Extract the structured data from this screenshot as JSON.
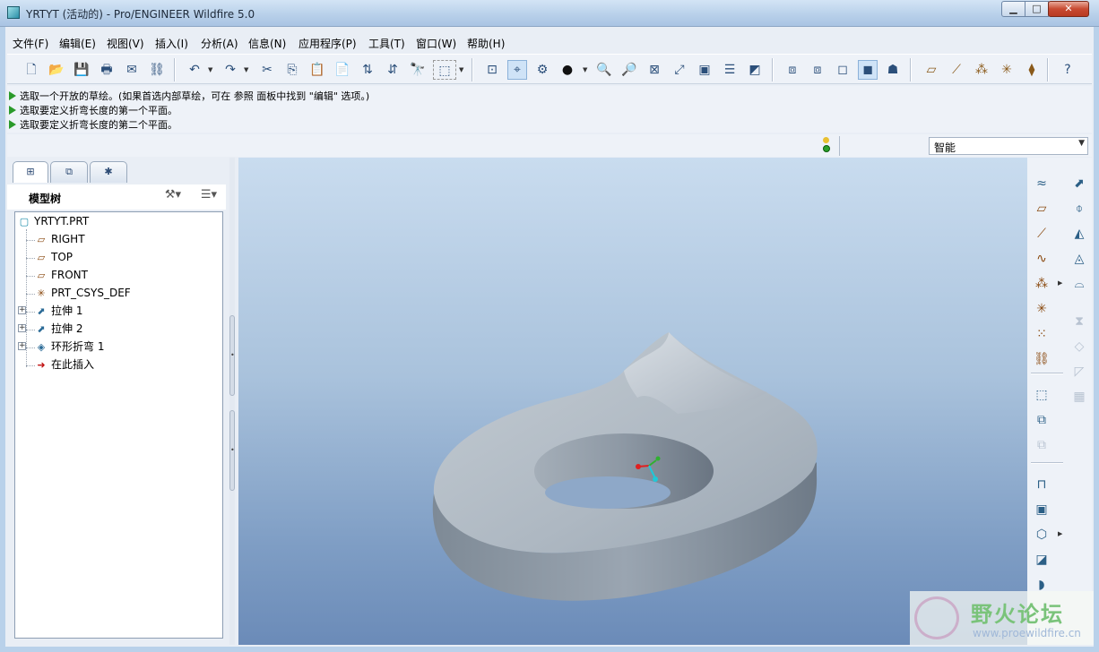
{
  "window": {
    "title": "YRTYT (活动的) - Pro/ENGINEER Wildfire 5.0",
    "min_glyph": "▁",
    "max_glyph": "□",
    "close_glyph": "✕"
  },
  "menu": {
    "items": [
      "文件(F)",
      "编辑(E)",
      "视图(V)",
      "插入(I)",
      "分析(A)",
      "信息(N)",
      "应用程序(P)",
      "工具(T)",
      "窗口(W)",
      "帮助(H)"
    ]
  },
  "toolbar": {
    "icons": [
      "new-icon",
      "open-icon",
      "save-icon",
      "print-icon",
      "send-mail-icon",
      "send-link-icon",
      "undo-icon",
      "redo-icon",
      "cut-icon",
      "copy-icon",
      "paste-icon",
      "paste-special-icon",
      "regenerate-icon",
      "regen-manager-icon",
      "find-icon",
      "select-box-icon",
      "repaint-icon",
      "spin-center-icon",
      "orient-icon",
      "saved-views-icon",
      "zoom-in-icon",
      "zoom-out-icon",
      "refit-icon",
      "reorient-icon",
      "view-manager-icon",
      "layers-icon",
      "appearance-icon",
      "wireframe-icon",
      "hidden-line-icon",
      "no-hidden-icon",
      "shading-icon",
      "enhanced-realism-icon",
      "datum-planes-display-icon",
      "datum-axes-display-icon",
      "point-display-icon",
      "csys-display-icon",
      "annotation-display-icon",
      "context-help-icon"
    ]
  },
  "messages": [
    "选取一个开放的草绘。(如果首选内部草绘，可在 参照 面板中找到 \"编辑\" 选项。)",
    "选取要定义折弯长度的第一个平面。",
    "选取要定义折弯长度的第二个平面。"
  ],
  "filter": {
    "value": "智能",
    "arrow": "▼"
  },
  "model_tree": {
    "title": "模型树",
    "settings_glyph": "⚒▾",
    "show_glyph": "☰▾",
    "tabs": [
      "⊞",
      "⧉",
      "✱"
    ],
    "nodes": [
      {
        "label": "YRTYT.PRT",
        "icon": "part-icon",
        "glyph": "▢"
      },
      {
        "label": "RIGHT",
        "icon": "datum-plane-icon",
        "glyph": "▱"
      },
      {
        "label": "TOP",
        "icon": "datum-plane-icon",
        "glyph": "▱"
      },
      {
        "label": "FRONT",
        "icon": "datum-plane-icon",
        "glyph": "▱"
      },
      {
        "label": "PRT_CSYS_DEF",
        "icon": "csys-icon",
        "glyph": "✳"
      },
      {
        "label": "拉伸 1",
        "icon": "extrude-icon",
        "glyph": "⬈",
        "expander": "+"
      },
      {
        "label": "拉伸 2",
        "icon": "extrude-icon",
        "glyph": "⬈",
        "expander": "+"
      },
      {
        "label": "环形折弯 1",
        "icon": "toroidal-bend-icon",
        "glyph": "◈",
        "expander": "+"
      },
      {
        "label": "在此插入",
        "icon": "insert-here-arrow-icon",
        "glyph": "➜"
      }
    ]
  },
  "right_toolbar": {
    "col1": [
      "sketched-datum-curve-icon",
      "datum-plane-tool-icon",
      "datum-axis-tool-icon",
      "datum-curve-tool-icon",
      "datum-point-tool-icon",
      "csys-tool-icon",
      "analysis-feature-icon",
      "datum-chain-icon",
      "extrude-tool-icon",
      "revolve-tool-icon",
      "variable-sweep-icon",
      "hole-tool-icon",
      "shell-tool-icon",
      "rib-tool-icon",
      "draft-tool-icon",
      "round-tool-icon"
    ],
    "col2": [
      "extrude-right-icon",
      "revolve-right-icon",
      "sweep-blend-icon",
      "boundary-blend-icon",
      "style-icon",
      "mirror-icon",
      "merge-icon",
      "trim-icon",
      "pattern-icon"
    ]
  },
  "watermark": {
    "cn": "野火论坛",
    "url": "www.proewildfire.cn"
  }
}
